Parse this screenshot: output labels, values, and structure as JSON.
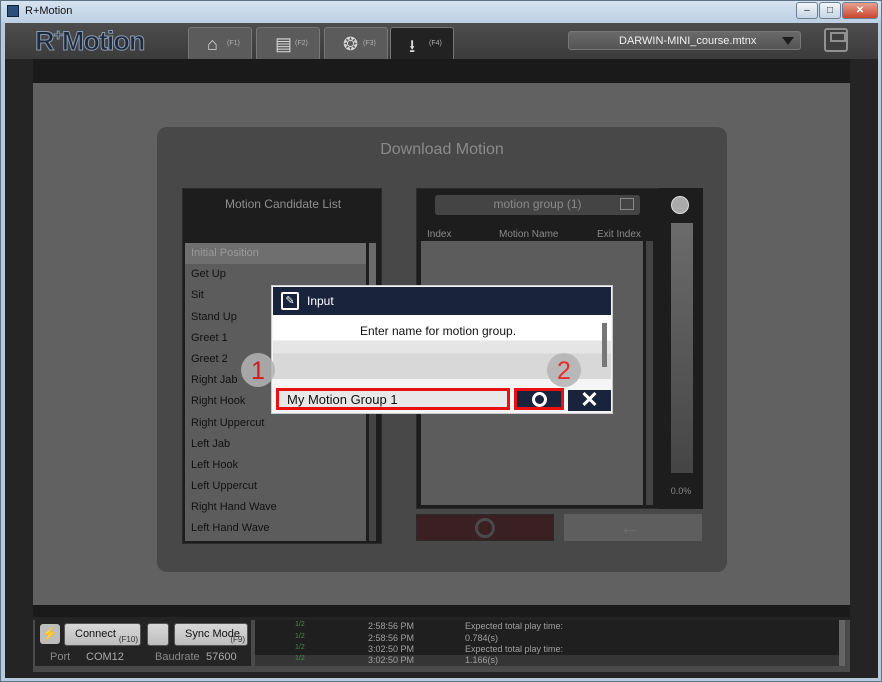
{
  "window": {
    "title": "R+Motion",
    "min": "–",
    "max": "□",
    "close": "✕"
  },
  "header": {
    "logo": "Motion",
    "logo_prefix": "R",
    "logo_sup": "+",
    "tabs": [
      {
        "icon": "home-icon",
        "glyph": "⌂",
        "key": "(F1)"
      },
      {
        "icon": "film-icon",
        "glyph": "▤",
        "key": "(F2)"
      },
      {
        "icon": "film-reel-icon",
        "glyph": "❂",
        "key": "(F3)"
      },
      {
        "icon": "download-icon",
        "glyph": "⭳",
        "key": "(F4)"
      }
    ],
    "file": "DARWIN-MINI_course.mtnx"
  },
  "panel": {
    "title": "Download Motion",
    "candidate_title": "Motion Candidate List",
    "candidates": [
      "Initial Position",
      "Get Up",
      "Sit",
      "Stand Up",
      "Greet 1",
      "Greet 2",
      "Right Jab",
      "Right Hook",
      "Right Uppercut",
      "Left Jab",
      "Left Hook",
      "Left Uppercut",
      "Right Hand Wave",
      "Left Hand Wave"
    ],
    "group_title": "motion group (1)",
    "columns": [
      "Index",
      "Motion Name",
      "Exit Index"
    ],
    "gauge": "0.0%"
  },
  "dialog": {
    "title": "Input",
    "message": "Enter name for motion group.",
    "value": "My Motion Group 1",
    "cancel": "✕",
    "step1": "1",
    "step2": "2"
  },
  "status": {
    "connect": "Connect",
    "connect_key": "(F10)",
    "sync": "Sync Mode",
    "sync_key": "(F9)",
    "port_label": "Port",
    "port": "COM12",
    "baud_label": "Baudrate",
    "baud": "57600",
    "log": [
      {
        "tag": "1/2",
        "time": "2:58:56 PM",
        "msg": "Expected total play time:"
      },
      {
        "tag": "1/2",
        "time": "2:58:56 PM",
        "msg": "0.784(s)"
      },
      {
        "tag": "1/2",
        "time": "3:02:50 PM",
        "msg": "Expected total play time:"
      },
      {
        "tag": "1/2",
        "time": "3:02:50 PM",
        "msg": "1.166(s)"
      }
    ]
  },
  "colors": {
    "accent": "#19243c",
    "highlight": "#e81010"
  }
}
